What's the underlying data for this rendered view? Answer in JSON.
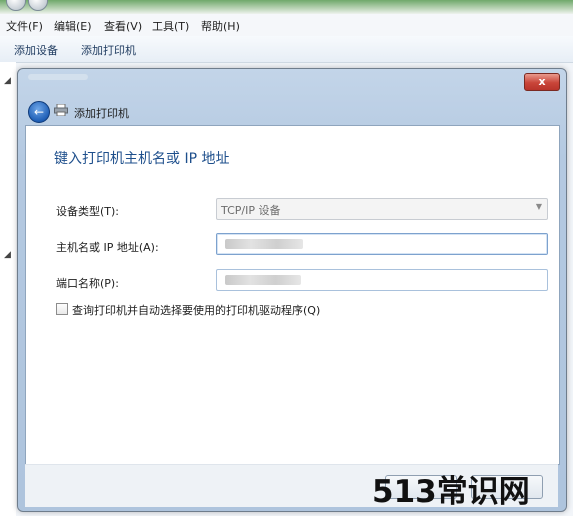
{
  "menubar": {
    "items": [
      "文件(F)",
      "编辑(E)",
      "查看(V)",
      "工具(T)",
      "帮助(H)"
    ]
  },
  "commandbar": {
    "add_device": "添加设备",
    "add_printer": "添加打印机"
  },
  "dialog": {
    "close_label": "x",
    "nav_title": "添加打印机",
    "heading": "键入打印机主机名或 IP 地址",
    "device_type_label": "设备类型(T):",
    "device_type_value": "TCP/IP 设备",
    "hostname_label": "主机名或 IP 地址(A):",
    "port_label": "端口名称(P):",
    "query_checkbox_label": "查询打印机并自动选择要使用的打印机驱动程序(Q)",
    "query_checked": false
  },
  "watermark": "513常识网",
  "colors": {
    "heading": "#1e4f8c",
    "close_button": "#c9453a",
    "window_frame": "#b4c9e1"
  }
}
